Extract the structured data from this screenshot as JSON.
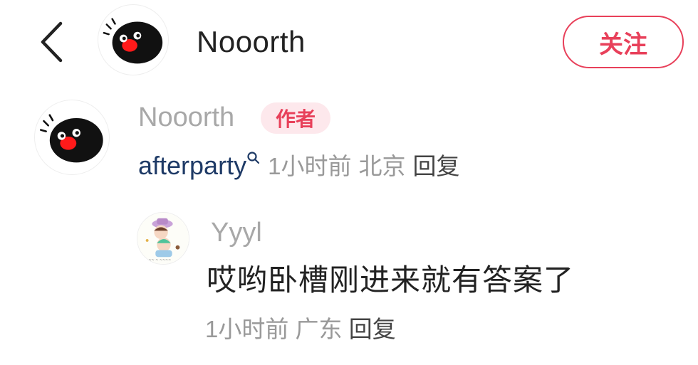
{
  "header": {
    "back_icon": "chevron-left-icon",
    "author_name": "Nooorth",
    "follow_label": "关注"
  },
  "colors": {
    "accent": "#e8405a",
    "badge_bg": "#fde8ec",
    "link_text": "#1e3a66",
    "muted_text": "#999999"
  },
  "comments": [
    {
      "username": "Nooorth",
      "badge": "作者",
      "text": "afterparty",
      "text_icon": "search-icon",
      "time": "1小时前",
      "location": "北京",
      "reply_label": "回复"
    },
    {
      "username": "Yyyl",
      "text": "哎哟卧槽刚进来就有答案了",
      "time": "1小时前",
      "location": "广东",
      "reply_label": "回复"
    }
  ]
}
